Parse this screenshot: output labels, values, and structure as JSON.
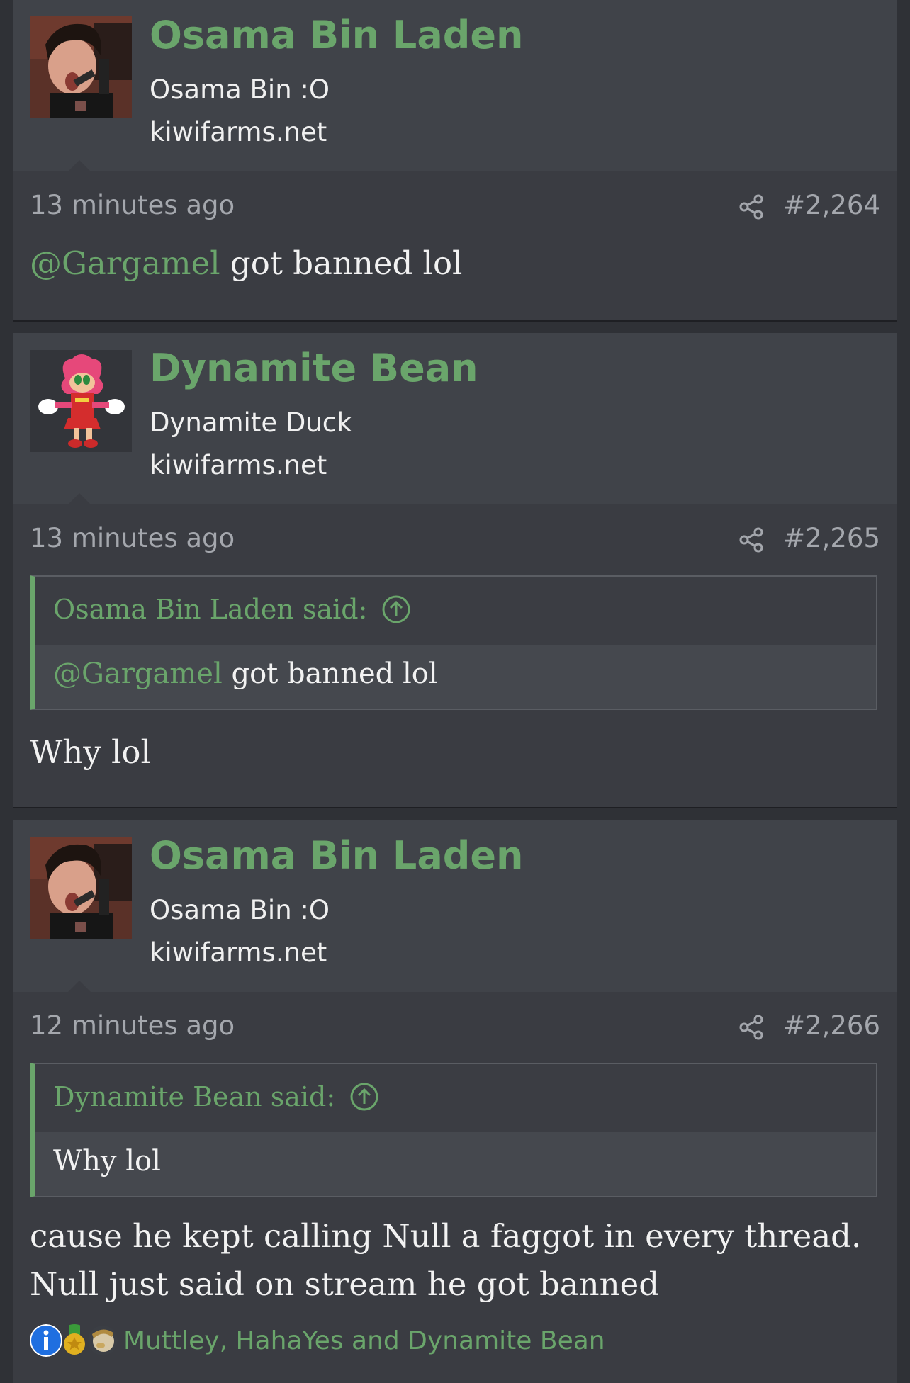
{
  "posts": [
    {
      "user": {
        "name": "Osama Bin Laden",
        "title": "Osama Bin :O",
        "site": "kiwifarms.net",
        "avatar": "user-photo-avatar"
      },
      "time": "13 minutes ago",
      "number": "#2,264",
      "body": {
        "mention": "@Gargamel",
        "text": " got banned lol"
      }
    },
    {
      "user": {
        "name": "Dynamite Bean",
        "title": "Dynamite Duck",
        "site": "kiwifarms.net",
        "avatar": "pink-hedgehog-avatar"
      },
      "time": "13 minutes ago",
      "number": "#2,265",
      "quote": {
        "attribution": "Osama Bin Laden said:",
        "mention": "@Gargamel",
        "text": " got banned lol"
      },
      "body": {
        "text": "Why lol"
      }
    },
    {
      "user": {
        "name": "Osama Bin Laden",
        "title": "Osama Bin :O",
        "site": "kiwifarms.net",
        "avatar": "user-photo-avatar"
      },
      "time": "12 minutes ago",
      "number": "#2,266",
      "quote": {
        "attribution": "Dynamite Bean said:",
        "text": "Why lol"
      },
      "body": {
        "line1": "cause he kept calling Null a faggot in every thread.",
        "line2": "Null just said on stream he got banned"
      },
      "reactions": {
        "icons": [
          "informative-icon",
          "winner-medal-icon",
          "thunk-provoking-icon"
        ],
        "users": "Muttley, HahaYes and Dynamite Bean"
      }
    }
  ],
  "colors": {
    "accent": "#6aa56b",
    "background": "#2f3136",
    "post": "#3a3c42",
    "header": "#404349",
    "muted": "#a4a7ad"
  }
}
